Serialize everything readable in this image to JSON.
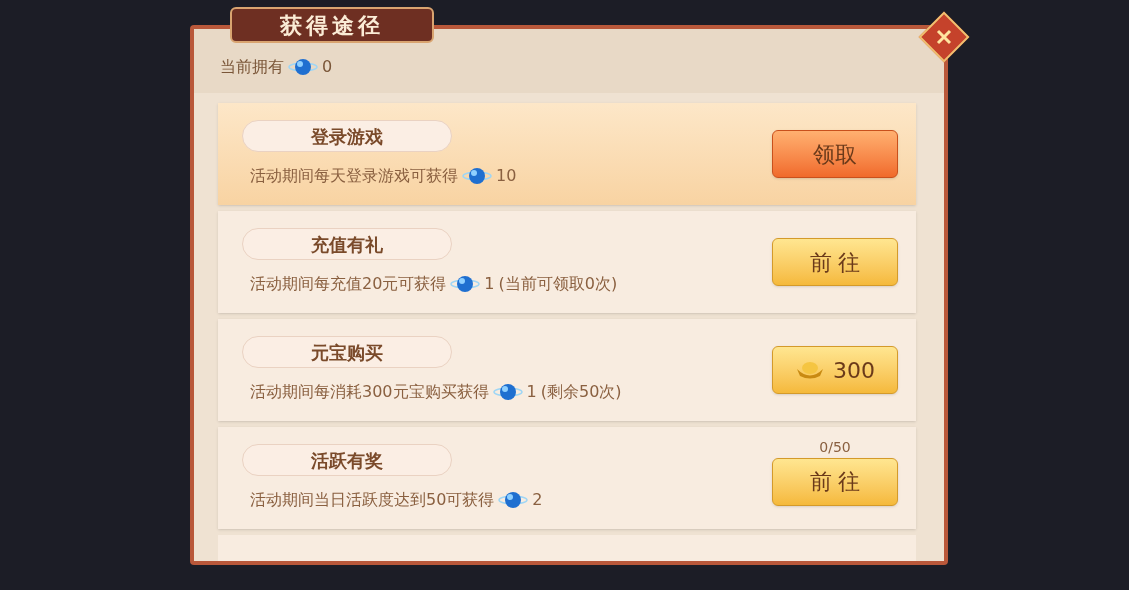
{
  "title": "获得途径",
  "owned": {
    "label": "当前拥有",
    "value": "0"
  },
  "tasks": [
    {
      "title": "登录游戏",
      "highlighted": true,
      "description": "活动期间每天登录游戏可获得",
      "amount": "10",
      "button": {
        "kind": "claim",
        "label": "领取"
      }
    },
    {
      "title": "充值有礼",
      "highlighted": false,
      "description": "活动期间每充值20元可获得",
      "amount": "1",
      "note": "(当前可领取0次)",
      "button": {
        "kind": "go",
        "label": "前 往"
      }
    },
    {
      "title": "元宝购买",
      "highlighted": false,
      "description": "活动期间每消耗300元宝购买获得",
      "amount": "1",
      "note": "(剩余50次)",
      "button": {
        "kind": "price",
        "label": "300"
      }
    },
    {
      "title": "活跃有奖",
      "highlighted": false,
      "description": "活动期间当日活跃度达到50可获得",
      "amount": "2",
      "progress": "0/50",
      "button": {
        "kind": "go",
        "label": "前 往"
      }
    }
  ]
}
